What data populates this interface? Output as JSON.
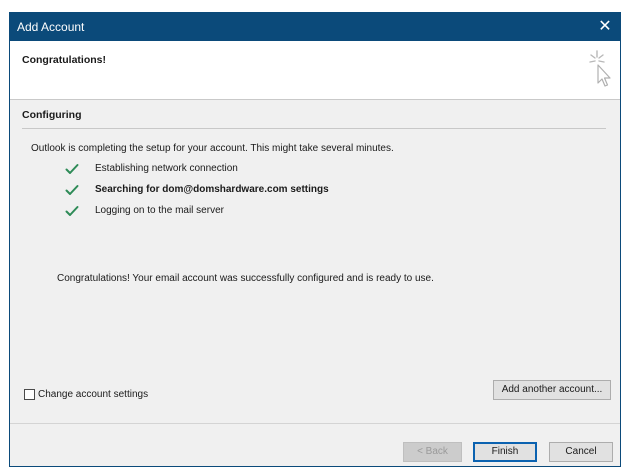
{
  "window": {
    "title": "Add Account",
    "close_glyph": "✕"
  },
  "header": {
    "heading": "Congratulations!",
    "icon": "wizard-cursor-sparkle-icon"
  },
  "section": {
    "title": "Configuring",
    "intro": "Outlook is completing the setup for your account. This might take several minutes."
  },
  "steps": [
    {
      "label": "Establishing network connection",
      "status": "done"
    },
    {
      "label": "Searching for dom@domshardware.com settings",
      "status": "done"
    },
    {
      "label": "Logging on to the mail server",
      "status": "done"
    }
  ],
  "success_message": "Congratulations! Your email account was successfully configured and is ready to use.",
  "options": {
    "change_settings_label": "Change account settings",
    "change_settings_checked": false,
    "add_another_label": "Add another account..."
  },
  "footer": {
    "back_label": "< Back",
    "back_enabled": false,
    "finish_label": "Finish",
    "cancel_label": "Cancel"
  },
  "colors": {
    "titlebar": "#0b4a7a",
    "check": "#2e8b57",
    "default_button_border": "#0b62b0"
  }
}
